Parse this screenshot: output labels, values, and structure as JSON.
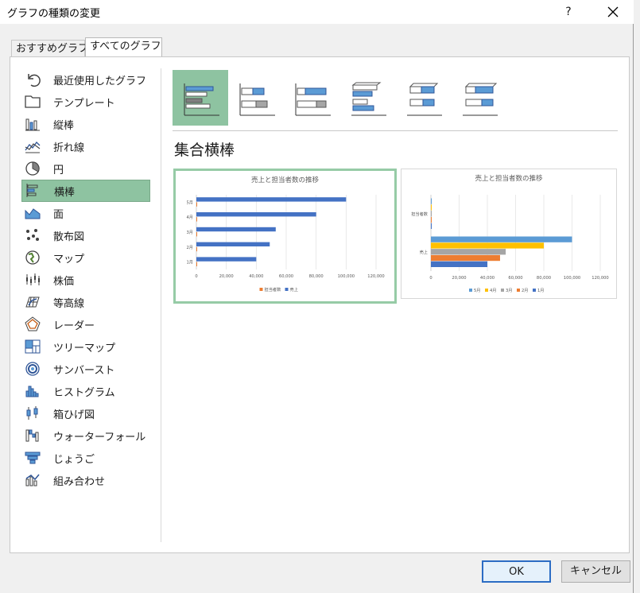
{
  "window": {
    "title": "グラフの種類の変更",
    "help": "?",
    "close": "✕"
  },
  "tabs": [
    {
      "label": "おすすめグラフ"
    },
    {
      "label": "すべてのグラフ"
    }
  ],
  "sidebar": {
    "items": [
      {
        "label": "最近使用したグラフ",
        "icon": "recent-icon"
      },
      {
        "label": "テンプレート",
        "icon": "folder-icon"
      },
      {
        "label": "縦棒",
        "icon": "column-chart-icon"
      },
      {
        "label": "折れ線",
        "icon": "line-chart-icon"
      },
      {
        "label": "円",
        "icon": "pie-chart-icon"
      },
      {
        "label": "横棒",
        "icon": "bar-chart-icon"
      },
      {
        "label": "面",
        "icon": "area-chart-icon"
      },
      {
        "label": "散布図",
        "icon": "scatter-chart-icon"
      },
      {
        "label": "マップ",
        "icon": "map-chart-icon"
      },
      {
        "label": "株価",
        "icon": "stock-chart-icon"
      },
      {
        "label": "等高線",
        "icon": "surface-chart-icon"
      },
      {
        "label": "レーダー",
        "icon": "radar-chart-icon"
      },
      {
        "label": "ツリーマップ",
        "icon": "treemap-icon"
      },
      {
        "label": "サンバースト",
        "icon": "sunburst-icon"
      },
      {
        "label": "ヒストグラム",
        "icon": "histogram-icon"
      },
      {
        "label": "箱ひげ図",
        "icon": "boxwhisker-icon"
      },
      {
        "label": "ウォーターフォール",
        "icon": "waterfall-icon"
      },
      {
        "label": "じょうご",
        "icon": "funnel-icon"
      },
      {
        "label": "組み合わせ",
        "icon": "combo-chart-icon"
      }
    ],
    "selected_index": 5
  },
  "subtypes": {
    "selected_index": 0,
    "items": [
      "clustered-bar-icon",
      "stacked-bar-icon",
      "stacked-100-bar-icon",
      "3d-clustered-bar-icon",
      "3d-stacked-bar-icon",
      "3d-stacked-100-bar-icon"
    ]
  },
  "section_title": "集合横棒",
  "colors": {
    "blue": "#4472c4",
    "orange": "#ed7d31",
    "gray": "#a5a5a5",
    "yellow": "#ffc000",
    "lightblue": "#5b9bd5",
    "selected": "#8ec3a1"
  },
  "chart_data": [
    {
      "type": "bar",
      "orientation": "horizontal",
      "title": "売上と担当者数の推移",
      "categories": [
        "1月",
        "2月",
        "3月",
        "4月",
        "5月"
      ],
      "series": [
        {
          "name": "担当者数",
          "color": "#ed7d31",
          "values": [
            3,
            3,
            3,
            4,
            4
          ]
        },
        {
          "name": "売上",
          "color": "#4472c4",
          "values": [
            40000,
            49000,
            53000,
            80000,
            100000
          ]
        }
      ],
      "xlim": [
        0,
        120000
      ],
      "xticks": [
        "0",
        "20,000",
        "40,000",
        "60,000",
        "80,000",
        "100,000",
        "120,000"
      ],
      "grid": true,
      "legend": "bottom"
    },
    {
      "type": "bar",
      "orientation": "horizontal",
      "title": "売上と担当者数の推移",
      "categories": [
        "売上",
        "担当者数"
      ],
      "series": [
        {
          "name": "1月",
          "color": "#4472c4",
          "values": [
            40000,
            3
          ]
        },
        {
          "name": "2月",
          "color": "#ed7d31",
          "values": [
            49000,
            3
          ]
        },
        {
          "name": "3月",
          "color": "#a5a5a5",
          "values": [
            53000,
            3
          ]
        },
        {
          "name": "4月",
          "color": "#ffc000",
          "values": [
            80000,
            4
          ]
        },
        {
          "name": "5月",
          "color": "#5b9bd5",
          "values": [
            100000,
            4
          ]
        }
      ],
      "legend_order": [
        "5月",
        "4月",
        "3月",
        "2月",
        "1月"
      ],
      "xlim": [
        0,
        120000
      ],
      "xticks": [
        "0",
        "20,000",
        "40,000",
        "60,000",
        "80,000",
        "100,000",
        "120,000"
      ],
      "grid": true,
      "legend": "bottom"
    }
  ],
  "buttons": {
    "ok": "OK",
    "cancel": "キャンセル"
  }
}
